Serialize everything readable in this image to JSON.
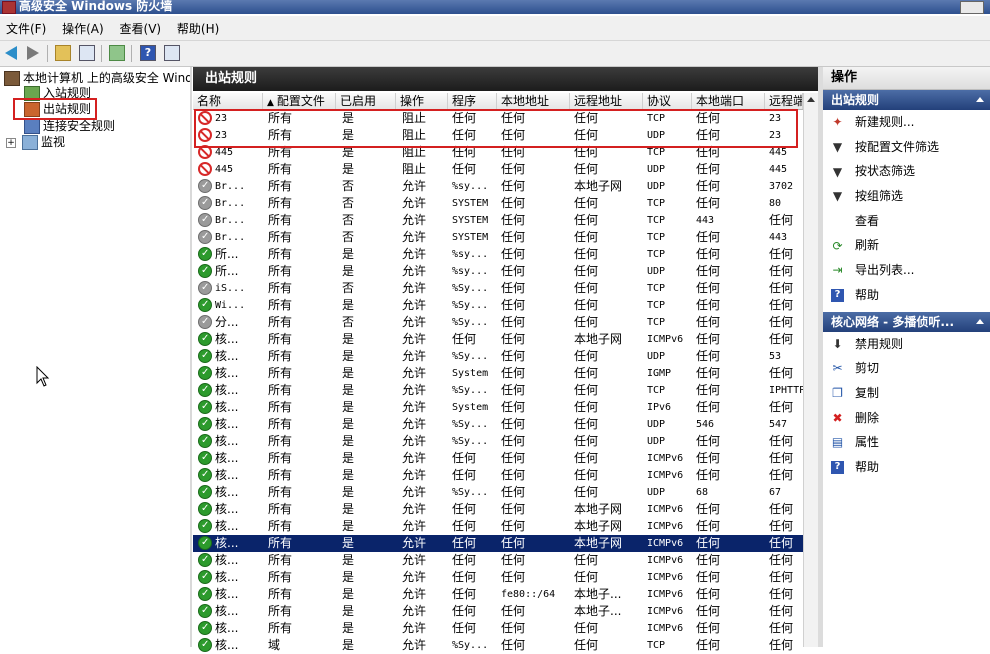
{
  "window": {
    "title": "高级安全 Windows 防火墙"
  },
  "menu": [
    "文件(F)",
    "操作(A)",
    "查看(V)",
    "帮助(H)"
  ],
  "tree": {
    "root": "本地计算机 上的高级安全 Windows 防火墙",
    "items": [
      "入站规则",
      "出站规则",
      "连接安全规则",
      "监视"
    ]
  },
  "center": {
    "title": "出站规则",
    "columns": [
      "名称",
      "配置文件",
      "已启用",
      "操作",
      "程序",
      "本地地址",
      "远程地址",
      "协议",
      "本地端口",
      "远程端口"
    ],
    "rows": [
      {
        "icon": "block",
        "name": "23",
        "profile": "所有",
        "enabled": "是",
        "action": "阻止",
        "program": "任何",
        "local": "任何",
        "remote": "任何",
        "protocol": "TCP",
        "lport": "任何",
        "rport": "23"
      },
      {
        "icon": "block",
        "name": "23",
        "profile": "所有",
        "enabled": "是",
        "action": "阻止",
        "program": "任何",
        "local": "任何",
        "remote": "任何",
        "protocol": "UDP",
        "lport": "任何",
        "rport": "23"
      },
      {
        "icon": "block",
        "name": "445",
        "profile": "所有",
        "enabled": "是",
        "action": "阻止",
        "program": "任何",
        "local": "任何",
        "remote": "任何",
        "protocol": "TCP",
        "lport": "任何",
        "rport": "445"
      },
      {
        "icon": "block",
        "name": "445",
        "profile": "所有",
        "enabled": "是",
        "action": "阻止",
        "program": "任何",
        "local": "任何",
        "remote": "任何",
        "protocol": "UDP",
        "lport": "任何",
        "rport": "445"
      },
      {
        "icon": "dis",
        "name": "Br...",
        "profile": "所有",
        "enabled": "否",
        "action": "允许",
        "program": "%sy...",
        "local": "任何",
        "remote": "本地子网",
        "protocol": "UDP",
        "lport": "任何",
        "rport": "3702"
      },
      {
        "icon": "dis",
        "name": "Br...",
        "profile": "所有",
        "enabled": "否",
        "action": "允许",
        "program": "SYSTEM",
        "local": "任何",
        "remote": "任何",
        "protocol": "TCP",
        "lport": "任何",
        "rport": "80"
      },
      {
        "icon": "dis",
        "name": "Br...",
        "profile": "所有",
        "enabled": "否",
        "action": "允许",
        "program": "SYSTEM",
        "local": "任何",
        "remote": "任何",
        "protocol": "TCP",
        "lport": "443",
        "rport": "任何"
      },
      {
        "icon": "dis",
        "name": "Br...",
        "profile": "所有",
        "enabled": "否",
        "action": "允许",
        "program": "SYSTEM",
        "local": "任何",
        "remote": "任何",
        "protocol": "TCP",
        "lport": "任何",
        "rport": "443"
      },
      {
        "icon": "allow",
        "name": "所...",
        "profile": "所有",
        "enabled": "是",
        "action": "允许",
        "program": "%sy...",
        "local": "任何",
        "remote": "任何",
        "protocol": "TCP",
        "lport": "任何",
        "rport": "任何"
      },
      {
        "icon": "allow",
        "name": "所...",
        "profile": "所有",
        "enabled": "是",
        "action": "允许",
        "program": "%sy...",
        "local": "任何",
        "remote": "任何",
        "protocol": "UDP",
        "lport": "任何",
        "rport": "任何"
      },
      {
        "icon": "dis",
        "name": "iS...",
        "profile": "所有",
        "enabled": "否",
        "action": "允许",
        "program": "%Sy...",
        "local": "任何",
        "remote": "任何",
        "protocol": "TCP",
        "lport": "任何",
        "rport": "任何"
      },
      {
        "icon": "allow",
        "name": "Wi...",
        "profile": "所有",
        "enabled": "是",
        "action": "允许",
        "program": "%Sy...",
        "local": "任何",
        "remote": "任何",
        "protocol": "TCP",
        "lport": "任何",
        "rport": "任何"
      },
      {
        "icon": "dis",
        "name": "分...",
        "profile": "所有",
        "enabled": "否",
        "action": "允许",
        "program": "%Sy...",
        "local": "任何",
        "remote": "任何",
        "protocol": "TCP",
        "lport": "任何",
        "rport": "任何"
      },
      {
        "icon": "allow",
        "name": "核...",
        "profile": "所有",
        "enabled": "是",
        "action": "允许",
        "program": "任何",
        "local": "任何",
        "remote": "本地子网",
        "protocol": "ICMPv6",
        "lport": "任何",
        "rport": "任何"
      },
      {
        "icon": "allow",
        "name": "核...",
        "profile": "所有",
        "enabled": "是",
        "action": "允许",
        "program": "%Sy...",
        "local": "任何",
        "remote": "任何",
        "protocol": "UDP",
        "lport": "任何",
        "rport": "53"
      },
      {
        "icon": "allow",
        "name": "核...",
        "profile": "所有",
        "enabled": "是",
        "action": "允许",
        "program": "System",
        "local": "任何",
        "remote": "任何",
        "protocol": "IGMP",
        "lport": "任何",
        "rport": "任何"
      },
      {
        "icon": "allow",
        "name": "核...",
        "profile": "所有",
        "enabled": "是",
        "action": "允许",
        "program": "%Sy...",
        "local": "任何",
        "remote": "任何",
        "protocol": "TCP",
        "lport": "任何",
        "rport": "IPHTTP"
      },
      {
        "icon": "allow",
        "name": "核...",
        "profile": "所有",
        "enabled": "是",
        "action": "允许",
        "program": "System",
        "local": "任何",
        "remote": "任何",
        "protocol": "IPv6",
        "lport": "任何",
        "rport": "任何"
      },
      {
        "icon": "allow",
        "name": "核...",
        "profile": "所有",
        "enabled": "是",
        "action": "允许",
        "program": "%Sy...",
        "local": "任何",
        "remote": "任何",
        "protocol": "UDP",
        "lport": "546",
        "rport": "547"
      },
      {
        "icon": "allow",
        "name": "核...",
        "profile": "所有",
        "enabled": "是",
        "action": "允许",
        "program": "%Sy...",
        "local": "任何",
        "remote": "任何",
        "protocol": "UDP",
        "lport": "任何",
        "rport": "任何"
      },
      {
        "icon": "allow",
        "name": "核...",
        "profile": "所有",
        "enabled": "是",
        "action": "允许",
        "program": "任何",
        "local": "任何",
        "remote": "任何",
        "protocol": "ICMPv6",
        "lport": "任何",
        "rport": "任何"
      },
      {
        "icon": "allow",
        "name": "核...",
        "profile": "所有",
        "enabled": "是",
        "action": "允许",
        "program": "任何",
        "local": "任何",
        "remote": "任何",
        "protocol": "ICMPv6",
        "lport": "任何",
        "rport": "任何"
      },
      {
        "icon": "allow",
        "name": "核...",
        "profile": "所有",
        "enabled": "是",
        "action": "允许",
        "program": "%Sy...",
        "local": "任何",
        "remote": "任何",
        "protocol": "UDP",
        "lport": "68",
        "rport": "67"
      },
      {
        "icon": "allow",
        "name": "核...",
        "profile": "所有",
        "enabled": "是",
        "action": "允许",
        "program": "任何",
        "local": "任何",
        "remote": "本地子网",
        "protocol": "ICMPv6",
        "lport": "任何",
        "rport": "任何"
      },
      {
        "icon": "allow",
        "name": "核...",
        "profile": "所有",
        "enabled": "是",
        "action": "允许",
        "program": "任何",
        "local": "任何",
        "remote": "本地子网",
        "protocol": "ICMPv6",
        "lport": "任何",
        "rport": "任何"
      },
      {
        "icon": "allow",
        "name": "核...",
        "profile": "所有",
        "enabled": "是",
        "action": "允许",
        "program": "任何",
        "local": "任何",
        "remote": "本地子网",
        "protocol": "ICMPv6",
        "lport": "任何",
        "rport": "任何",
        "selected": true
      },
      {
        "icon": "allow",
        "name": "核...",
        "profile": "所有",
        "enabled": "是",
        "action": "允许",
        "program": "任何",
        "local": "任何",
        "remote": "任何",
        "protocol": "ICMPv6",
        "lport": "任何",
        "rport": "任何"
      },
      {
        "icon": "allow",
        "name": "核...",
        "profile": "所有",
        "enabled": "是",
        "action": "允许",
        "program": "任何",
        "local": "任何",
        "remote": "任何",
        "protocol": "ICMPv6",
        "lport": "任何",
        "rport": "任何"
      },
      {
        "icon": "allow",
        "name": "核...",
        "profile": "所有",
        "enabled": "是",
        "action": "允许",
        "program": "任何",
        "local": "fe80::/64",
        "remote": "本地子...",
        "protocol": "ICMPv6",
        "lport": "任何",
        "rport": "任何"
      },
      {
        "icon": "allow",
        "name": "核...",
        "profile": "所有",
        "enabled": "是",
        "action": "允许",
        "program": "任何",
        "local": "任何",
        "remote": "本地子...",
        "protocol": "ICMPv6",
        "lport": "任何",
        "rport": "任何"
      },
      {
        "icon": "allow",
        "name": "核...",
        "profile": "所有",
        "enabled": "是",
        "action": "允许",
        "program": "任何",
        "local": "任何",
        "remote": "任何",
        "protocol": "ICMPv6",
        "lport": "任何",
        "rport": "任何"
      },
      {
        "icon": "allow",
        "name": "核...",
        "profile": "域",
        "enabled": "是",
        "action": "允许",
        "program": "%Sy...",
        "local": "任何",
        "remote": "任何",
        "protocol": "TCP",
        "lport": "任何",
        "rport": "任何"
      }
    ]
  },
  "actions": {
    "title": "操作",
    "section1": "出站规则",
    "items1": [
      {
        "label": "新建规则...",
        "icon": "new-rule-icon"
      },
      {
        "label": "按配置文件筛选",
        "icon": "filter-icon"
      },
      {
        "label": "按状态筛选",
        "icon": "filter-icon"
      },
      {
        "label": "按组筛选",
        "icon": "filter-icon"
      },
      {
        "label": "查看",
        "icon": "view-icon"
      },
      {
        "label": "刷新",
        "icon": "refresh-icon"
      },
      {
        "label": "导出列表...",
        "icon": "export-icon"
      },
      {
        "label": "帮助",
        "icon": "help-icon"
      }
    ],
    "section2": "核心网络 - 多播侦听...",
    "items2": [
      {
        "label": "禁用规则",
        "icon": "disable-icon"
      },
      {
        "label": "剪切",
        "icon": "cut-icon"
      },
      {
        "label": "复制",
        "icon": "copy-icon"
      },
      {
        "label": "删除",
        "icon": "delete-icon"
      },
      {
        "label": "属性",
        "icon": "properties-icon"
      },
      {
        "label": "帮助",
        "icon": "help-icon"
      }
    ]
  }
}
